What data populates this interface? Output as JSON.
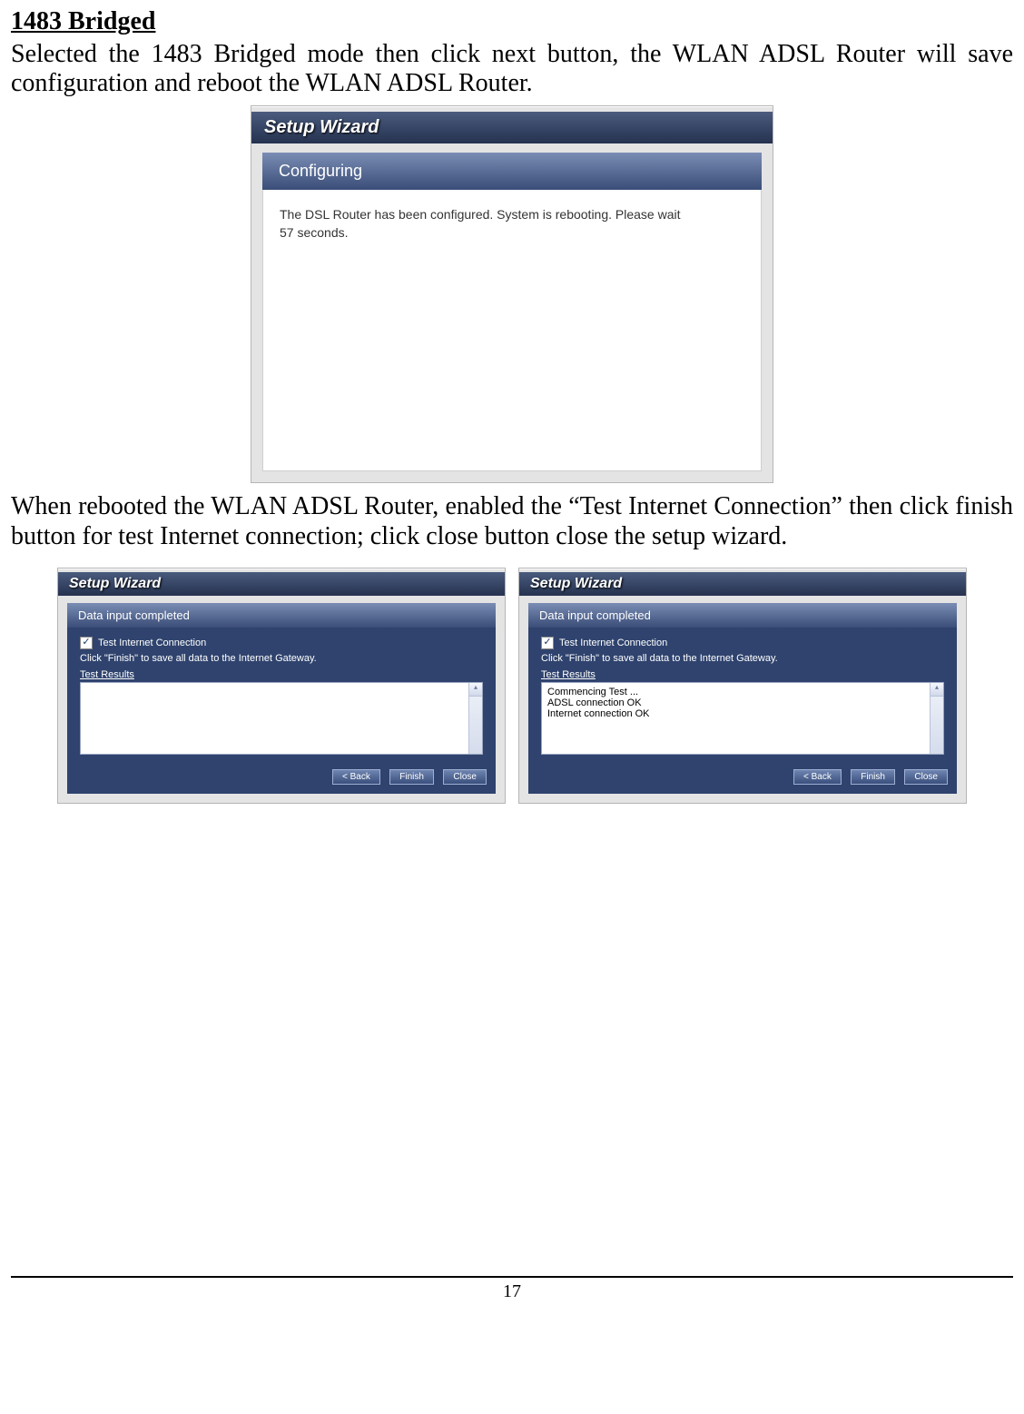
{
  "section": {
    "title": "1483 Bridged",
    "para1": "Selected the 1483 Bridged mode then click next button, the WLAN ADSL Router will save configuration and reboot the WLAN ADSL Router.",
    "para2": "When rebooted the WLAN ADSL Router, enabled the “Test Internet Connection” then click finish button for test Internet connection; click close button close the setup wizard."
  },
  "wizard_config": {
    "title": "Setup Wizard",
    "subtitle": "Configuring",
    "msg_line1": "The DSL Router has been configured. System is rebooting. Please wait",
    "msg_line2": "57 seconds."
  },
  "wizard_left": {
    "title": "Setup Wizard",
    "subtitle": "Data input completed",
    "checkbox_label": "Test Internet Connection",
    "help_text": "Click \"Finish\" to save all data to the Internet Gateway.",
    "results_label": "Test Results",
    "results_text": "",
    "btn_back": "< Back",
    "btn_finish": "Finish",
    "btn_close": "Close"
  },
  "wizard_right": {
    "title": "Setup Wizard",
    "subtitle": "Data input completed",
    "checkbox_label": "Test Internet Connection",
    "help_text": "Click \"Finish\" to save all data to the Internet Gateway.",
    "results_label": "Test Results",
    "results_line1": "Commencing Test ...",
    "results_line2": "ADSL connection OK",
    "results_line3": "Internet connection OK",
    "btn_back": "< Back",
    "btn_finish": "Finish",
    "btn_close": "Close"
  },
  "page_number": "17"
}
